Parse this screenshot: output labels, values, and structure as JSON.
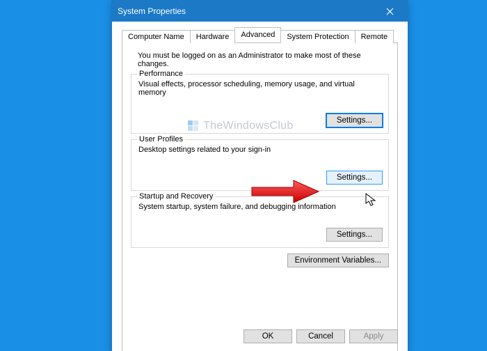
{
  "window": {
    "title": "System Properties"
  },
  "tabs": {
    "computer_name": "Computer Name",
    "hardware": "Hardware",
    "advanced": "Advanced",
    "system_protection": "System Protection",
    "remote": "Remote"
  },
  "intro": "You must be logged on as an Administrator to make most of these changes.",
  "groups": {
    "performance": {
      "title": "Performance",
      "desc": "Visual effects, processor scheduling, memory usage, and virtual memory",
      "button": "Settings..."
    },
    "user_profiles": {
      "title": "User Profiles",
      "desc": "Desktop settings related to your sign-in",
      "button": "Settings..."
    },
    "startup": {
      "title": "Startup and Recovery",
      "desc": "System startup, system failure, and debugging information",
      "button": "Settings..."
    }
  },
  "env_button": "Environment Variables...",
  "footer": {
    "ok": "OK",
    "cancel": "Cancel",
    "apply": "Apply"
  },
  "watermark": "TheWindowsClub"
}
